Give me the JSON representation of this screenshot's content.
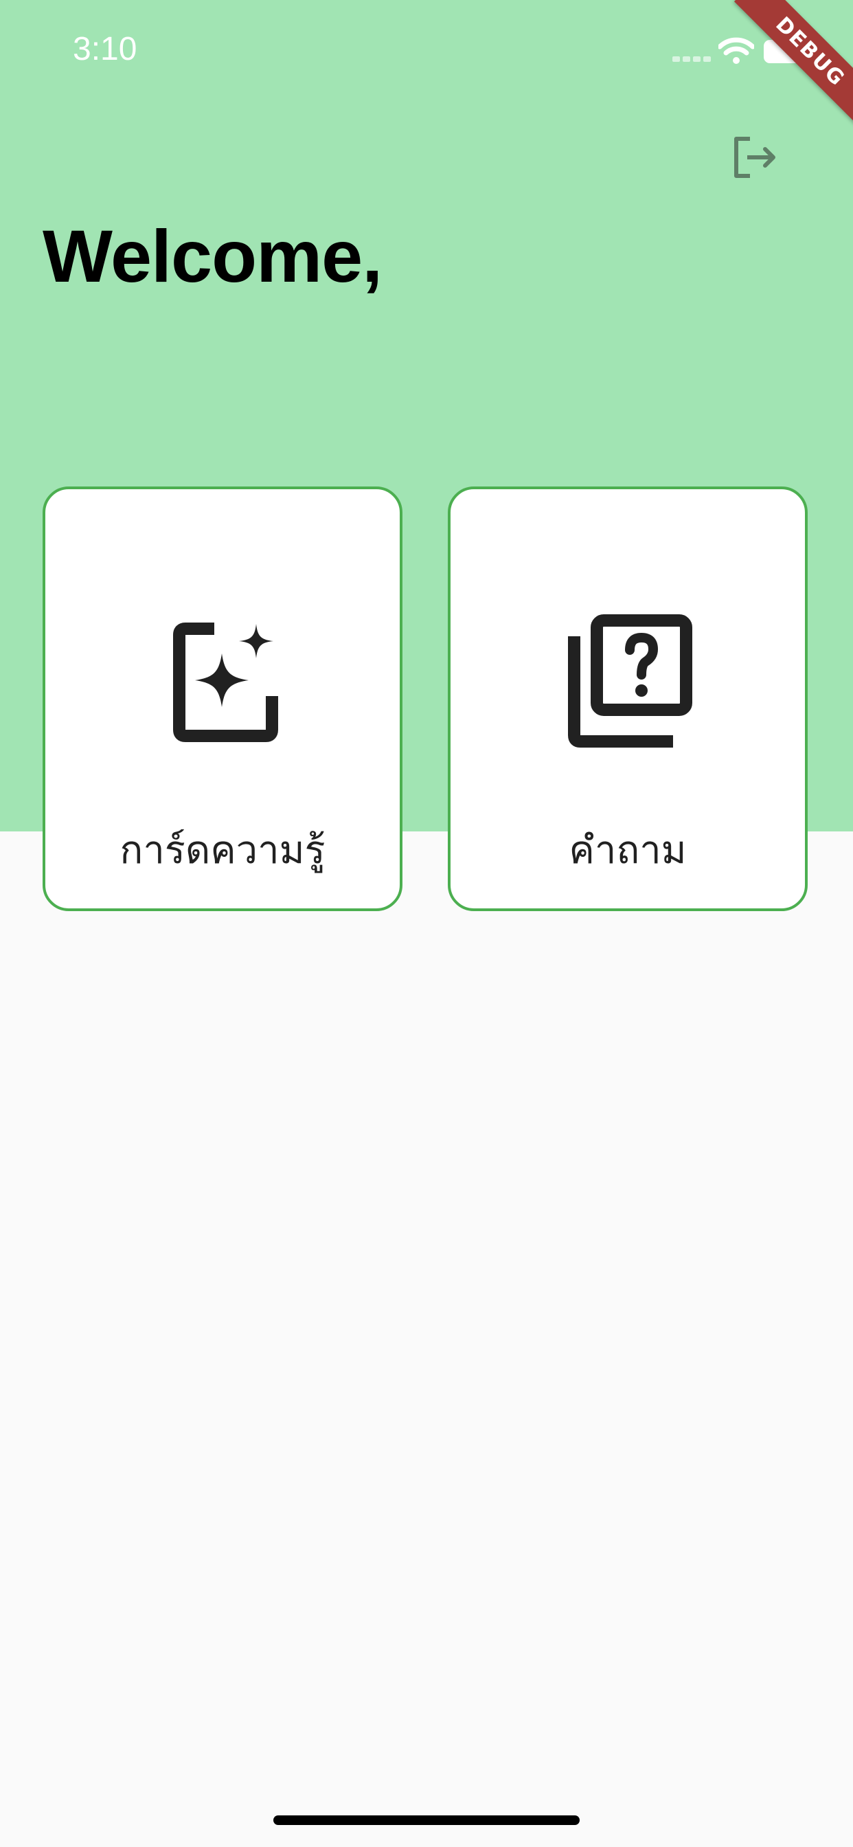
{
  "status_bar": {
    "time": "3:10"
  },
  "debug_banner": {
    "label": "DEBUG"
  },
  "header": {
    "welcome": "Welcome,",
    "logout_icon": "logout-icon"
  },
  "cards": [
    {
      "label": "การ์ดความรู้",
      "icon": "auto-awesome-frame-icon"
    },
    {
      "label": "คำถาม",
      "icon": "question-library-icon"
    }
  ],
  "colors": {
    "header_background": "#a1e4b3",
    "page_background": "#fafafa",
    "card_border": "#4caf50",
    "debug_banner": "#a43a36",
    "icon": "#212121"
  }
}
